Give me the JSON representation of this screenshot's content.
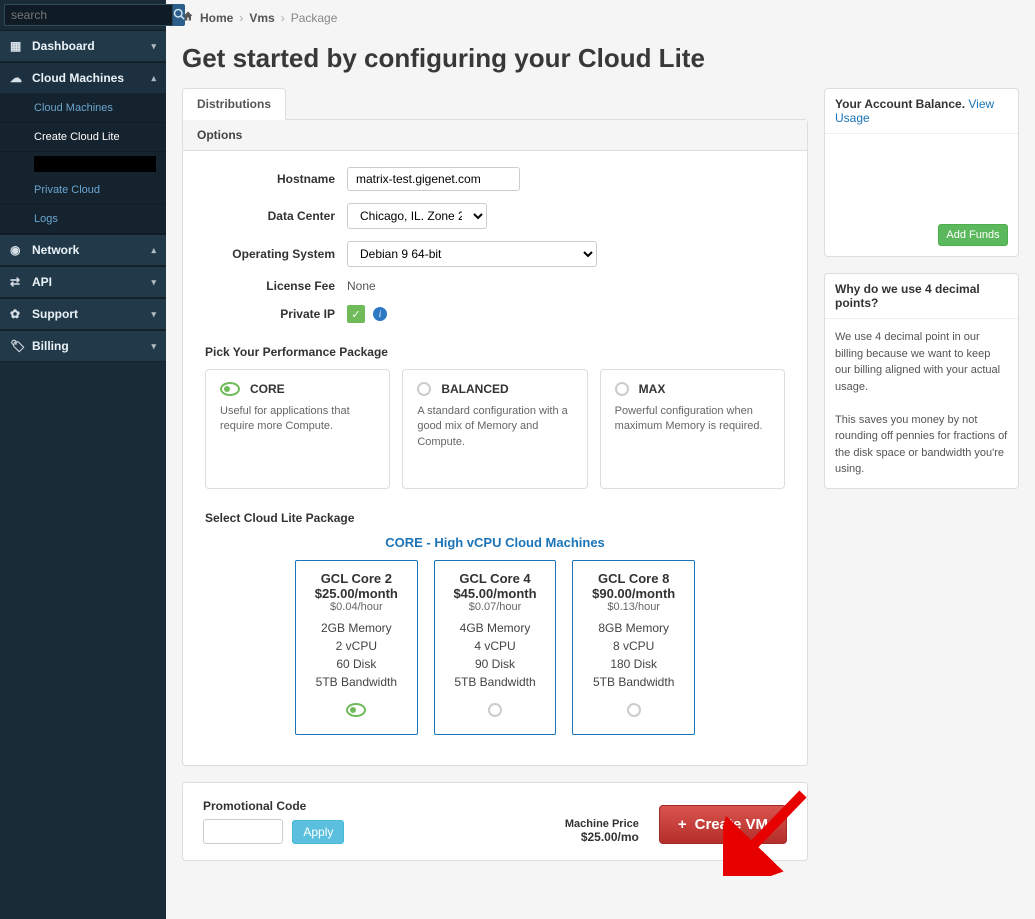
{
  "search": {
    "placeholder": "search"
  },
  "nav": {
    "dashboard": "Dashboard",
    "cloud_machines": "Cloud Machines",
    "sub_cloud_machines": "Cloud Machines",
    "sub_create": "Create Cloud Lite",
    "sub_private": "Private Cloud",
    "sub_logs": "Logs",
    "network": "Network",
    "api": "API",
    "support": "Support",
    "billing": "Billing"
  },
  "crumb": {
    "home": "Home",
    "vms": "Vms",
    "package": "Package"
  },
  "title": "Get started by configuring your Cloud Lite",
  "tab_dist": "Distributions",
  "options": {
    "head": "Options",
    "hostname_lbl": "Hostname",
    "hostname_val": "matrix-test.gigenet.com",
    "dc_lbl": "Data Center",
    "dc_val": "Chicago, IL. Zone 2",
    "os_lbl": "Operating System",
    "os_val": "Debian 9 64-bit",
    "fee_lbl": "License Fee",
    "fee_val": "None",
    "pip_lbl": "Private IP"
  },
  "perf": {
    "title": "Pick Your Performance Package",
    "core": {
      "name": "CORE",
      "desc": "Useful for applications that require more Compute."
    },
    "bal": {
      "name": "BALANCED",
      "desc": "A standard configuration with a good mix of Memory and Compute."
    },
    "max": {
      "name": "MAX",
      "desc": "Powerful configuration when maximum Memory is required."
    }
  },
  "pkg": {
    "title": "Select Cloud Lite Package",
    "group": "CORE - High vCPU Cloud Machines",
    "items": [
      {
        "name": "GCL Core 2",
        "price": "$25.00/month",
        "hour": "$0.04/hour",
        "mem": "2GB Memory",
        "cpu": "2 vCPU",
        "disk": "60 Disk",
        "bw": "5TB Bandwidth"
      },
      {
        "name": "GCL Core 4",
        "price": "$45.00/month",
        "hour": "$0.07/hour",
        "mem": "4GB Memory",
        "cpu": "4 vCPU",
        "disk": "90 Disk",
        "bw": "5TB Bandwidth"
      },
      {
        "name": "GCL Core 8",
        "price": "$90.00/month",
        "hour": "$0.13/hour",
        "mem": "8GB Memory",
        "cpu": "8 vCPU",
        "disk": "180 Disk",
        "bw": "5TB Bandwidth"
      }
    ]
  },
  "footer": {
    "promo_lbl": "Promotional Code",
    "apply": "Apply",
    "mprice_lbl": "Machine Price",
    "mprice_val": "$25.00/mo",
    "create": "Create VM"
  },
  "side": {
    "bal_lbl": "Your Account Balance.",
    "view": "View Usage",
    "addfunds": "Add Funds",
    "dec_title": "Why do we use 4 decimal points?",
    "dec_p1": "We use 4 decimal point in our billing because we want to keep our billing aligned with your actual usage.",
    "dec_p2": "This saves you money by not rounding off pennies for fractions of the disk space or bandwidth you're using."
  }
}
